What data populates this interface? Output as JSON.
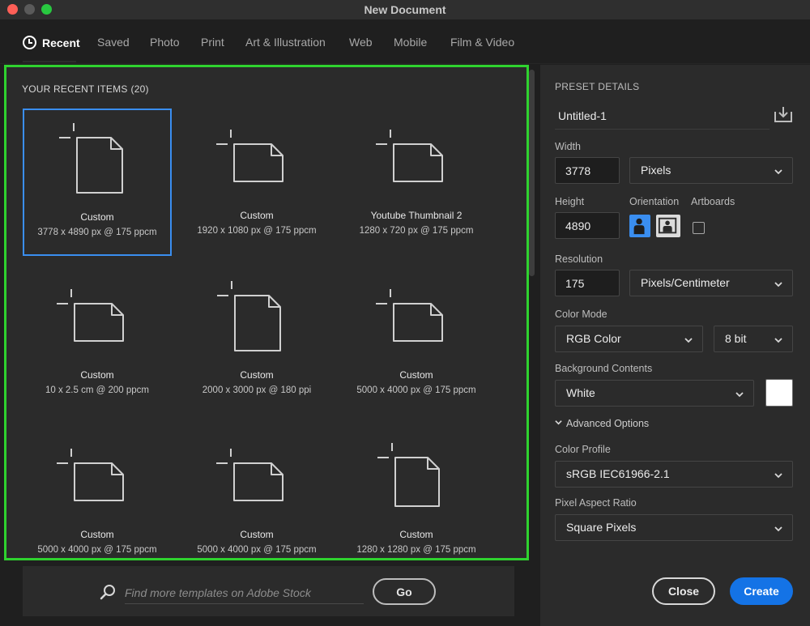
{
  "window": {
    "title": "New Document"
  },
  "tabs": [
    {
      "label": "Recent",
      "active": true
    },
    {
      "label": "Saved"
    },
    {
      "label": "Photo"
    },
    {
      "label": "Print"
    },
    {
      "label": "Art & Illustration"
    },
    {
      "label": "Web"
    },
    {
      "label": "Mobile"
    },
    {
      "label": "Film & Video"
    }
  ],
  "recent": {
    "heading": "YOUR RECENT ITEMS",
    "count": "(20)",
    "items": [
      {
        "name": "Custom",
        "details": "3778 x 4890 px @ 175 ppcm",
        "selected": true,
        "orientation": "portrait"
      },
      {
        "name": "Custom",
        "details": "1920 x 1080 px @ 175 ppcm",
        "orientation": "landscape"
      },
      {
        "name": "Youtube Thumbnail 2",
        "details": "1280 x 720 px @ 175 ppcm",
        "orientation": "landscape"
      },
      {
        "name": "Custom",
        "details": "10 x 2.5 cm @ 200 ppcm",
        "orientation": "landscape"
      },
      {
        "name": "Custom",
        "details": "2000 x 3000 px @ 180 ppi",
        "orientation": "portrait"
      },
      {
        "name": "Custom",
        "details": "5000 x 4000 px @ 175 ppcm",
        "orientation": "landscape"
      },
      {
        "name": "Custom",
        "details": "5000 x 4000 px @ 175 ppcm",
        "orientation": "landscape"
      },
      {
        "name": "Custom",
        "details": "5000 x 4000 px @ 175 ppcm",
        "orientation": "landscape"
      },
      {
        "name": "Custom",
        "details": "1280 x 1280 px @ 175 ppcm",
        "orientation": "square"
      }
    ]
  },
  "search": {
    "placeholder": "Find more templates on Adobe Stock",
    "go_label": "Go",
    "icon": "search-icon"
  },
  "preset": {
    "section_title": "PRESET DETAILS",
    "document_name": "Untitled-1",
    "save_icon": "save-preset-icon",
    "width_label": "Width",
    "width_value": "3778",
    "width_unit": "Pixels",
    "height_label": "Height",
    "height_value": "4890",
    "orientation_label": "Orientation",
    "orientation_selected": "portrait",
    "artboards_label": "Artboards",
    "artboards_checked": false,
    "resolution_label": "Resolution",
    "resolution_value": "175",
    "resolution_unit": "Pixels/Centimeter",
    "color_mode_label": "Color Mode",
    "color_mode": "RGB Color",
    "bit_depth": "8 bit",
    "background_label": "Background Contents",
    "background": "White",
    "background_swatch_color": "#ffffff",
    "advanced_label": "Advanced Options",
    "color_profile_label": "Color Profile",
    "color_profile": "sRGB IEC61966-2.1",
    "pixel_aspect_label": "Pixel Aspect Ratio",
    "pixel_aspect": "Square Pixels"
  },
  "actions": {
    "close_label": "Close",
    "create_label": "Create"
  },
  "colors": {
    "accent": "#1473e6",
    "selection": "#3a8ef0",
    "highlight_border": "#2fd22f"
  }
}
